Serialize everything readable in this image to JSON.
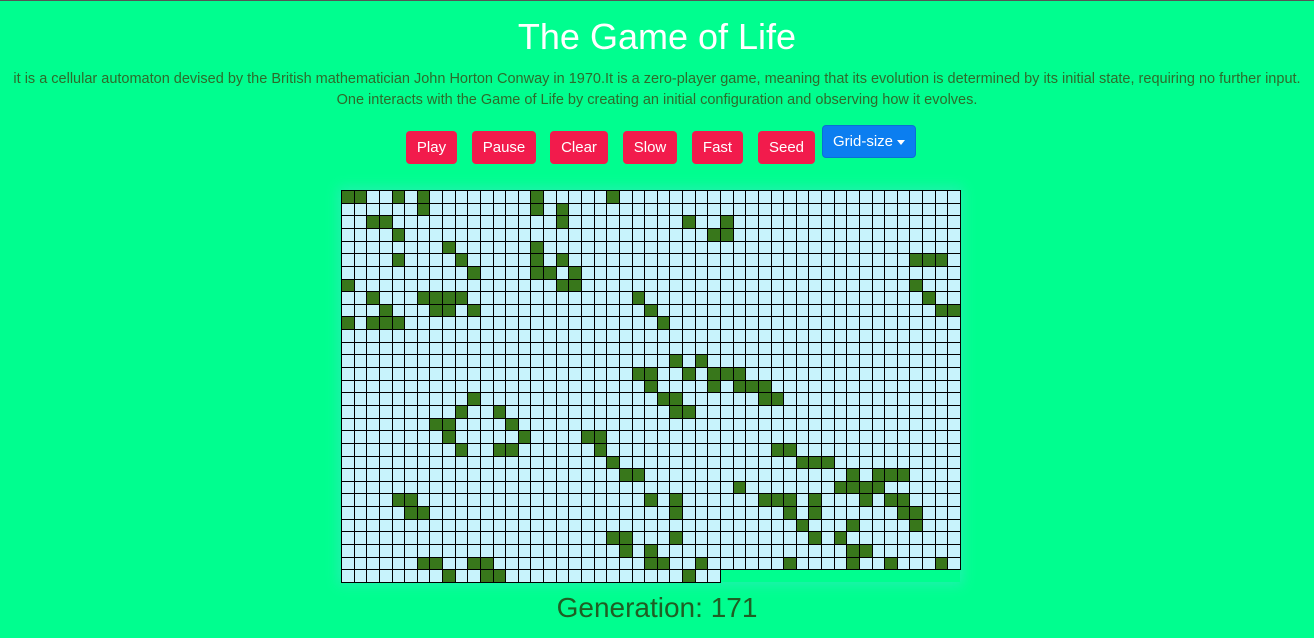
{
  "header": {
    "title": "The Game of Life",
    "description_line1": "it is a cellular automaton devised by the British mathematician John Horton Conway in 1970.It is a zero-player game, meaning that its evolution is determined by its initial state, requiring no further input.",
    "description_line2": "One interacts with the Game of Life by creating an initial configuration and observing how it evolves."
  },
  "controls": {
    "play": "Play",
    "pause": "Pause",
    "clear": "Clear",
    "slow": "Slow",
    "fast": "Fast",
    "seed": "Seed",
    "grid_size": "Grid-size"
  },
  "colors": {
    "background": "#00fe8f",
    "button": "#f21b4c",
    "dropdown": "#0b7ef0",
    "cell_alive": "#38771b",
    "cell_dead": "#c8f3fc"
  },
  "grid": {
    "rows": 31,
    "cols": 49,
    "filled_cells_last_row": 30,
    "alive": [
      [
        0,
        0
      ],
      [
        0,
        1
      ],
      [
        0,
        4
      ],
      [
        0,
        6
      ],
      [
        0,
        15
      ],
      [
        0,
        21
      ],
      [
        1,
        6
      ],
      [
        1,
        15
      ],
      [
        1,
        17
      ],
      [
        2,
        2
      ],
      [
        2,
        3
      ],
      [
        2,
        17
      ],
      [
        2,
        27
      ],
      [
        2,
        30
      ],
      [
        3,
        4
      ],
      [
        3,
        29
      ],
      [
        3,
        30
      ],
      [
        4,
        8
      ],
      [
        4,
        15
      ],
      [
        5,
        4
      ],
      [
        5,
        9
      ],
      [
        5,
        15
      ],
      [
        5,
        17
      ],
      [
        5,
        45
      ],
      [
        5,
        46
      ],
      [
        5,
        47
      ],
      [
        6,
        10
      ],
      [
        6,
        15
      ],
      [
        6,
        16
      ],
      [
        6,
        18
      ],
      [
        7,
        0
      ],
      [
        7,
        17
      ],
      [
        7,
        18
      ],
      [
        7,
        45
      ],
      [
        8,
        2
      ],
      [
        8,
        6
      ],
      [
        8,
        7
      ],
      [
        8,
        8
      ],
      [
        8,
        9
      ],
      [
        8,
        23
      ],
      [
        8,
        46
      ],
      [
        9,
        3
      ],
      [
        9,
        7
      ],
      [
        9,
        8
      ],
      [
        9,
        10
      ],
      [
        9,
        24
      ],
      [
        9,
        47
      ],
      [
        9,
        48
      ],
      [
        10,
        0
      ],
      [
        10,
        2
      ],
      [
        10,
        3
      ],
      [
        10,
        4
      ],
      [
        10,
        25
      ],
      [
        13,
        26
      ],
      [
        13,
        28
      ],
      [
        14,
        23
      ],
      [
        14,
        24
      ],
      [
        14,
        27
      ],
      [
        14,
        29
      ],
      [
        14,
        30
      ],
      [
        14,
        31
      ],
      [
        15,
        24
      ],
      [
        15,
        29
      ],
      [
        15,
        31
      ],
      [
        15,
        32
      ],
      [
        15,
        33
      ],
      [
        16,
        10
      ],
      [
        16,
        25
      ],
      [
        16,
        26
      ],
      [
        16,
        33
      ],
      [
        16,
        34
      ],
      [
        17,
        9
      ],
      [
        17,
        12
      ],
      [
        17,
        26
      ],
      [
        17,
        27
      ],
      [
        18,
        7
      ],
      [
        18,
        8
      ],
      [
        18,
        13
      ],
      [
        19,
        8
      ],
      [
        19,
        14
      ],
      [
        19,
        19
      ],
      [
        19,
        20
      ],
      [
        20,
        9
      ],
      [
        20,
        12
      ],
      [
        20,
        13
      ],
      [
        20,
        20
      ],
      [
        20,
        34
      ],
      [
        20,
        35
      ],
      [
        21,
        21
      ],
      [
        21,
        36
      ],
      [
        21,
        37
      ],
      [
        21,
        38
      ],
      [
        22,
        22
      ],
      [
        22,
        23
      ],
      [
        22,
        40
      ],
      [
        22,
        42
      ],
      [
        22,
        43
      ],
      [
        22,
        44
      ],
      [
        23,
        31
      ],
      [
        23,
        39
      ],
      [
        23,
        40
      ],
      [
        23,
        41
      ],
      [
        23,
        42
      ],
      [
        24,
        4
      ],
      [
        24,
        5
      ],
      [
        24,
        24
      ],
      [
        24,
        26
      ],
      [
        24,
        33
      ],
      [
        24,
        34
      ],
      [
        24,
        35
      ],
      [
        24,
        37
      ],
      [
        24,
        41
      ],
      [
        24,
        43
      ],
      [
        24,
        44
      ],
      [
        25,
        5
      ],
      [
        25,
        6
      ],
      [
        25,
        26
      ],
      [
        25,
        35
      ],
      [
        25,
        37
      ],
      [
        25,
        44
      ],
      [
        25,
        45
      ],
      [
        26,
        36
      ],
      [
        26,
        40
      ],
      [
        26,
        45
      ],
      [
        27,
        21
      ],
      [
        27,
        22
      ],
      [
        27,
        26
      ],
      [
        27,
        37
      ],
      [
        27,
        39
      ],
      [
        28,
        22
      ],
      [
        28,
        24
      ],
      [
        28,
        40
      ],
      [
        28,
        41
      ],
      [
        29,
        6
      ],
      [
        29,
        7
      ],
      [
        29,
        10
      ],
      [
        29,
        11
      ],
      [
        29,
        24
      ],
      [
        29,
        25
      ],
      [
        29,
        28
      ],
      [
        29,
        35
      ],
      [
        29,
        40
      ],
      [
        29,
        43
      ],
      [
        29,
        47
      ],
      [
        30,
        8
      ],
      [
        30,
        11
      ],
      [
        30,
        12
      ],
      [
        30,
        27
      ]
    ]
  },
  "status": {
    "generation": "Generation: 171"
  }
}
